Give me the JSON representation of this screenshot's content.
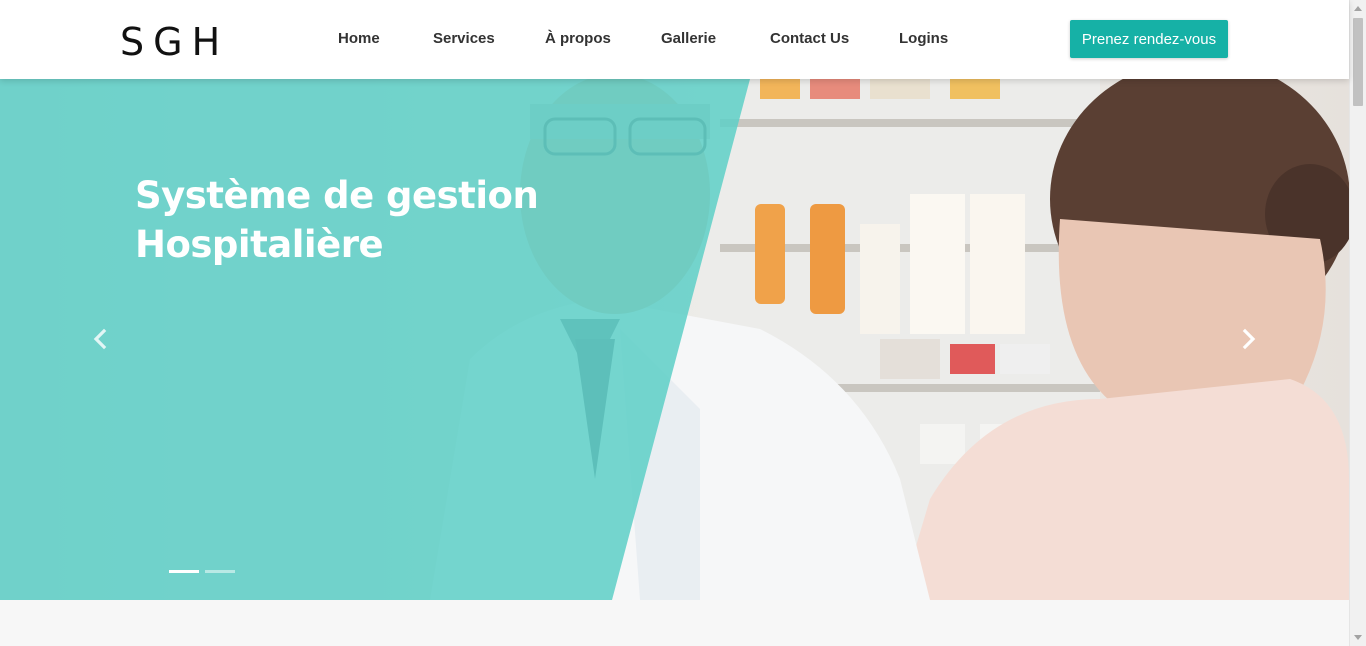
{
  "header": {
    "logo": "SGH",
    "nav": [
      {
        "label": "Home"
      },
      {
        "label": "Services"
      },
      {
        "label": "À propos"
      },
      {
        "label": "Gallerie"
      },
      {
        "label": "Contact Us"
      },
      {
        "label": "Logins"
      }
    ],
    "cta_label": "Prenez rendez-vous"
  },
  "hero": {
    "title_line1": "Système de gestion",
    "title_line2": "Hospitalière",
    "slides": 2,
    "active_slide": 1,
    "prev_icon": "chevron-left-icon",
    "next_icon": "chevron-right-icon"
  },
  "colors": {
    "accent": "#16b1a6",
    "overlay": "#5ecfc7"
  }
}
